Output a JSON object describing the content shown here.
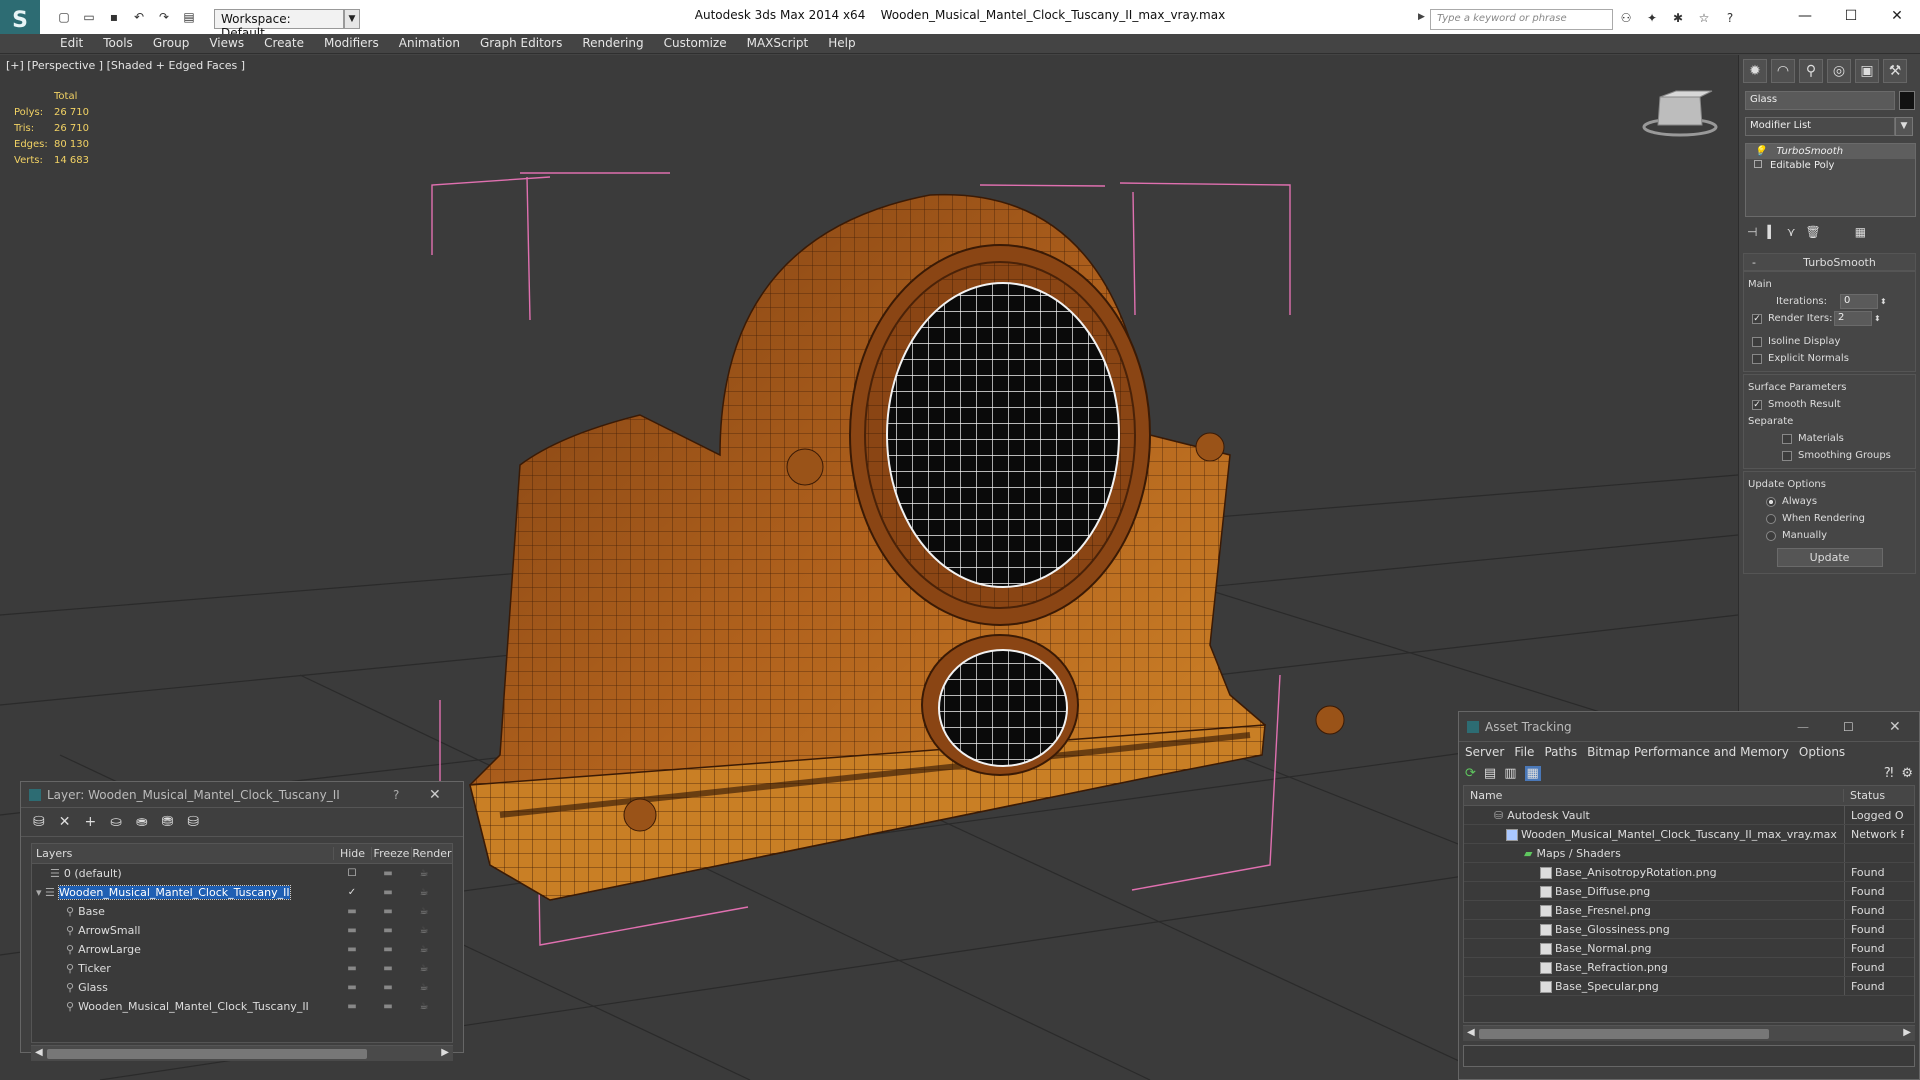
{
  "app": {
    "title": "Autodesk 3ds Max  2014 x64",
    "file": "Wooden_Musical_Mantel_Clock_Tuscany_II_max_vray.max",
    "workspace": "Workspace: Default",
    "search_placeholder": "Type a keyword or phrase"
  },
  "menu": [
    "Edit",
    "Tools",
    "Group",
    "Views",
    "Create",
    "Modifiers",
    "Animation",
    "Graph Editors",
    "Rendering",
    "Customize",
    "MAXScript",
    "Help"
  ],
  "viewport": {
    "label": "[+] [Perspective ] [Shaded + Edged Faces ]",
    "stats": {
      "header": "Total",
      "rows": [
        {
          "label": "Polys:",
          "value": "26 710"
        },
        {
          "label": "Tris:",
          "value": "26 710"
        },
        {
          "label": "Edges:",
          "value": "80 130"
        },
        {
          "label": "Verts:",
          "value": "14 683"
        }
      ]
    }
  },
  "command_panel": {
    "object_name": "Glass",
    "modifier_list": "Modifier List",
    "stack": [
      "TurboSmooth",
      "Editable Poly"
    ],
    "rollout_title": "TurboSmooth",
    "main_label": "Main",
    "iterations_label": "Iterations:",
    "iterations_value": "0",
    "render_iters_label": "Render Iters:",
    "render_iters_value": "2",
    "isoline": "Isoline Display",
    "explicit": "Explicit Normals",
    "surface_params": "Surface Parameters",
    "smooth_result": "Smooth Result",
    "separate": "Separate",
    "materials": "Materials",
    "smoothing_groups": "Smoothing Groups",
    "update_options": "Update Options",
    "always": "Always",
    "when_rendering": "When Rendering",
    "manually": "Manually",
    "update_btn": "Update"
  },
  "layer_dialog": {
    "title": "Layer: Wooden_Musical_Mantel_Clock_Tuscany_II",
    "help": "?",
    "cols": {
      "layers": "Layers",
      "hide": "Hide",
      "freeze": "Freeze",
      "render": "Render"
    },
    "rows": [
      {
        "name": "0 (default)",
        "indent": 0
      },
      {
        "name": "Wooden_Musical_Mantel_Clock_Tuscany_II",
        "indent": 0
      },
      {
        "name": "Base",
        "indent": 1
      },
      {
        "name": "ArrowSmall",
        "indent": 1
      },
      {
        "name": "ArrowLarge",
        "indent": 1
      },
      {
        "name": "Ticker",
        "indent": 1
      },
      {
        "name": "Glass",
        "indent": 1
      },
      {
        "name": "Wooden_Musical_Mantel_Clock_Tuscany_II",
        "indent": 1
      }
    ]
  },
  "asset_dialog": {
    "title": "Asset Tracking",
    "menu": [
      "Server",
      "File",
      "Paths",
      "Bitmap Performance and Memory",
      "Options"
    ],
    "cols": {
      "name": "Name",
      "status": "Status"
    },
    "rows": [
      {
        "name": "Autodesk Vault",
        "status": "Logged Ou"
      },
      {
        "name": "Wooden_Musical_Mantel_Clock_Tuscany_II_max_vray.max",
        "status": "Network P"
      },
      {
        "name": "Maps / Shaders",
        "status": ""
      },
      {
        "name": "Base_AnisotropyRotation.png",
        "status": "Found"
      },
      {
        "name": "Base_Diffuse.png",
        "status": "Found"
      },
      {
        "name": "Base_Fresnel.png",
        "status": "Found"
      },
      {
        "name": "Base_Glossiness.png",
        "status": "Found"
      },
      {
        "name": "Base_Normal.png",
        "status": "Found"
      },
      {
        "name": "Base_Refraction.png",
        "status": "Found"
      },
      {
        "name": "Base_Specular.png",
        "status": "Found"
      }
    ]
  },
  "colors": {
    "accent": "#1f5fb3",
    "stats": "#f2d264",
    "wood": "#a3561b",
    "bbox": "#e070b0"
  }
}
